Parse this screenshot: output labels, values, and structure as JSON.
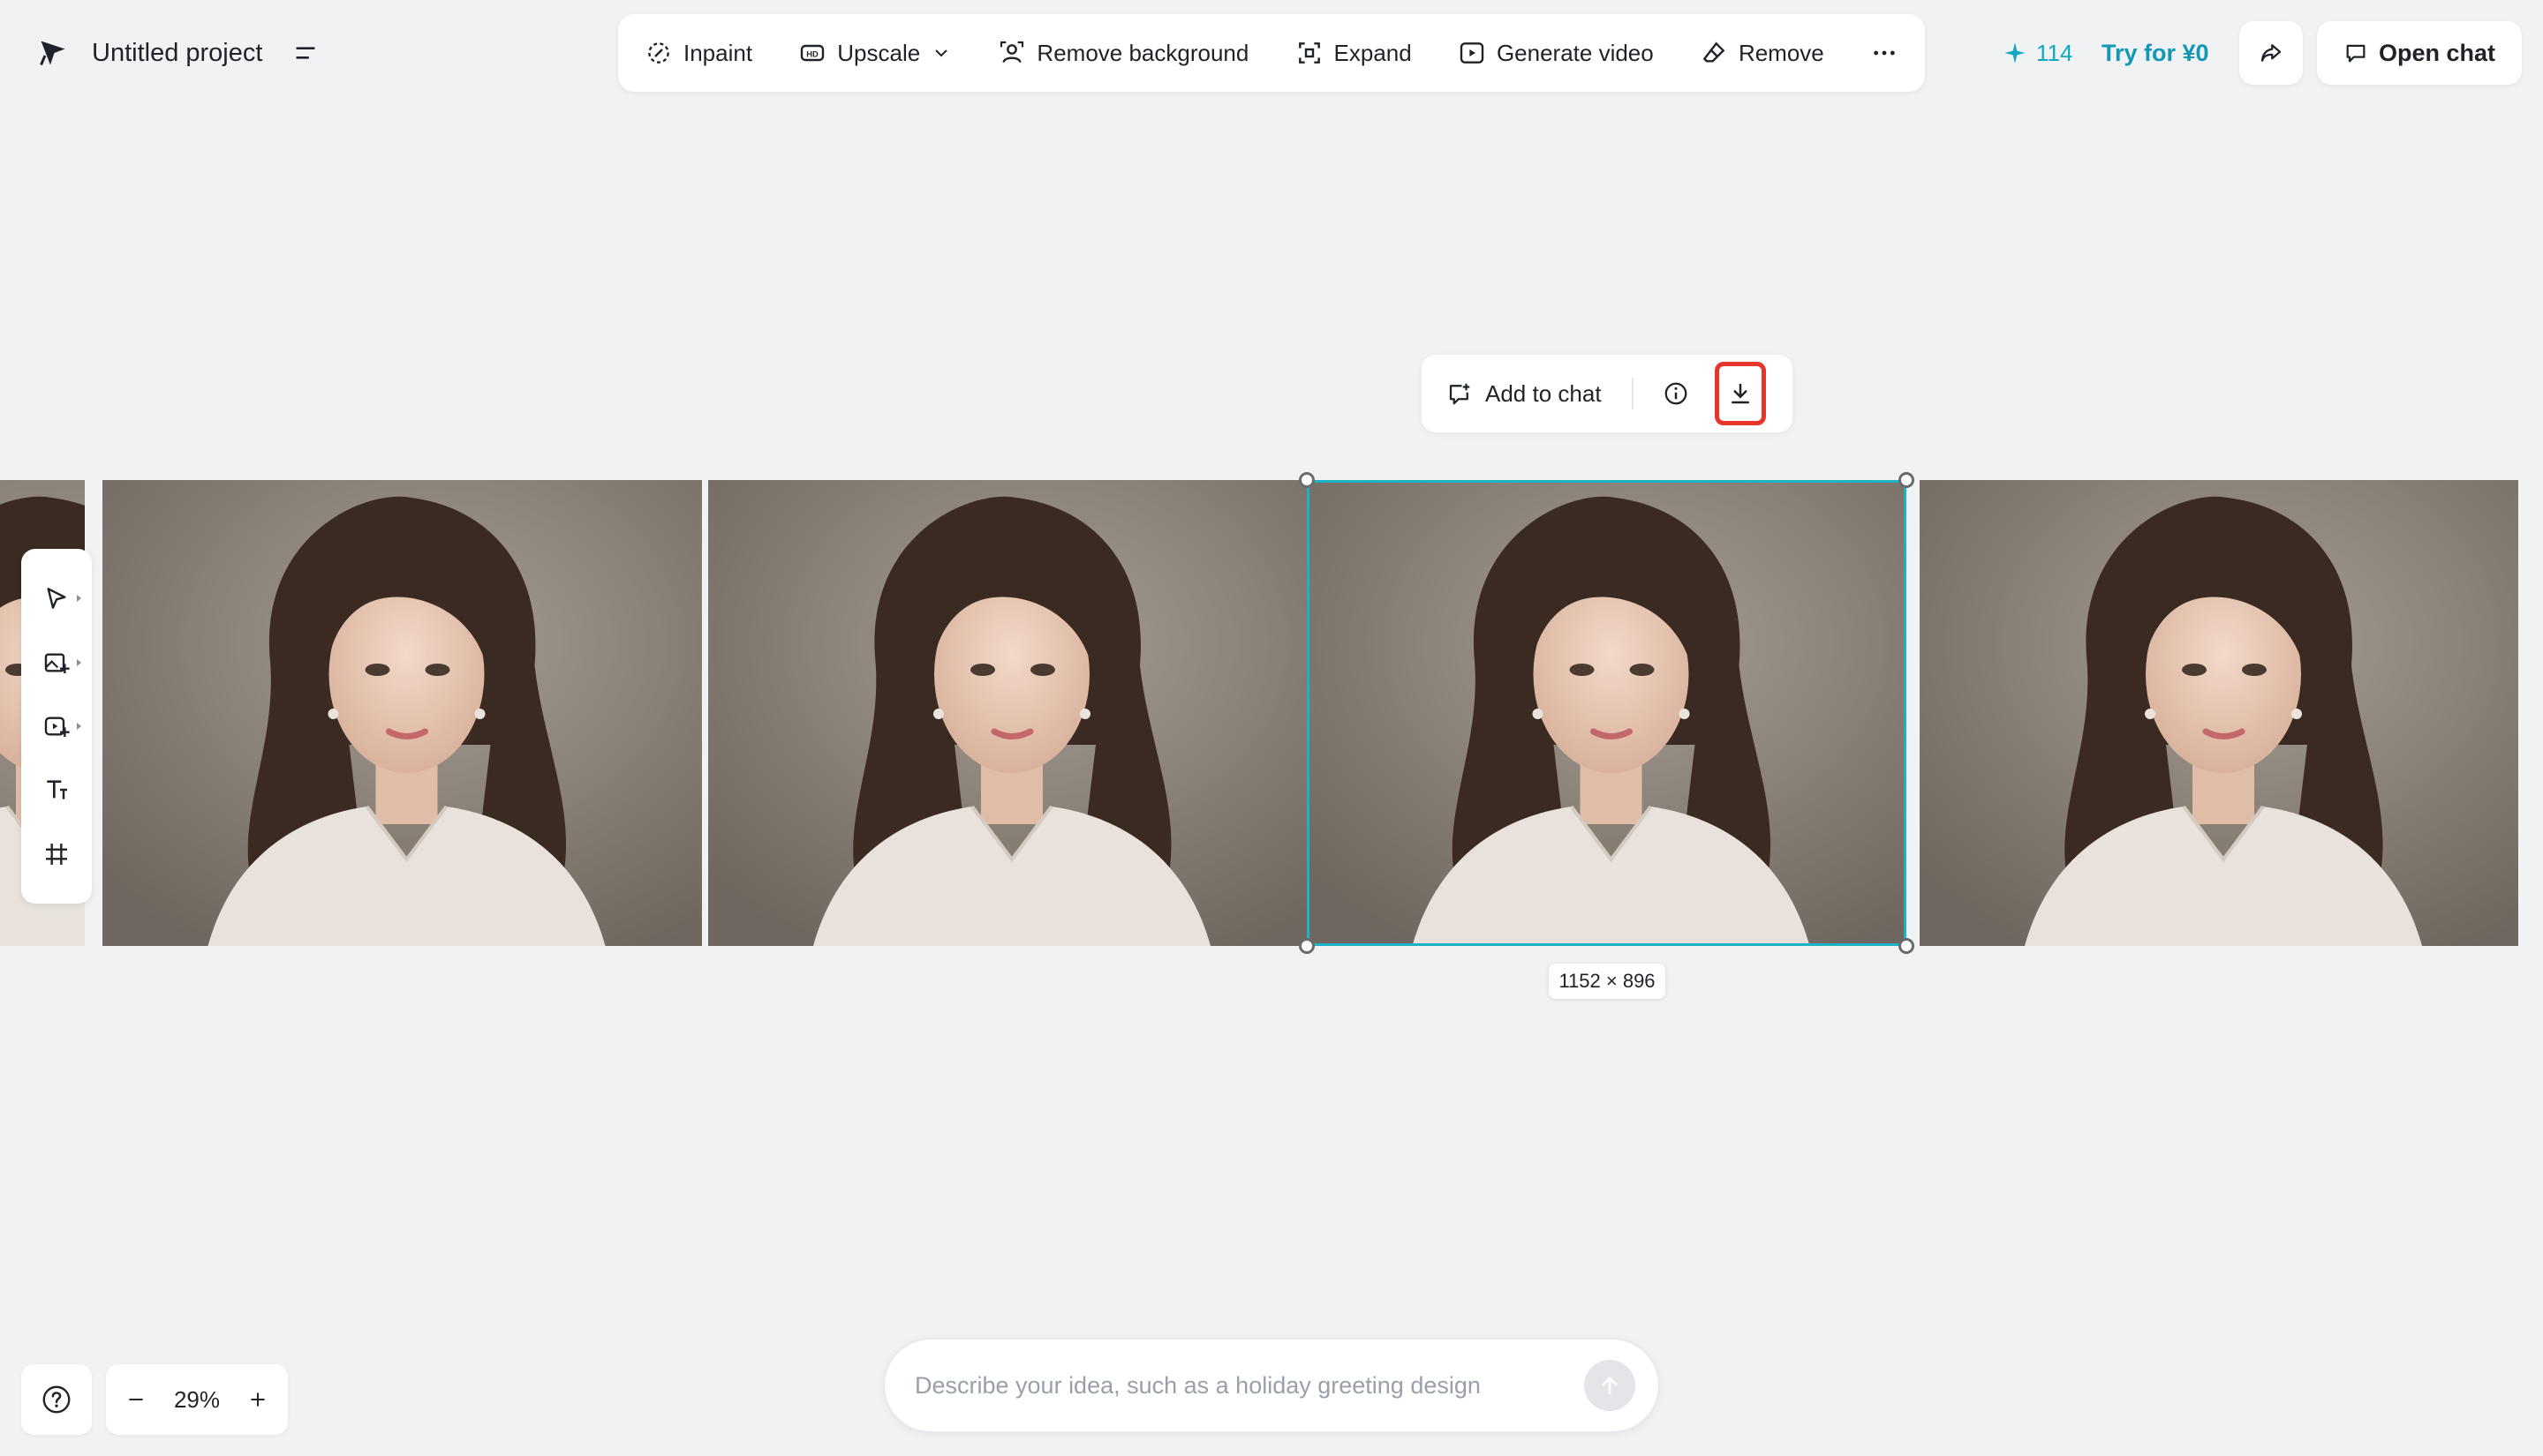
{
  "header": {
    "project_title": "Untitled project"
  },
  "toolbar": {
    "items": [
      {
        "label": "Inpaint",
        "icon": "inpaint-icon"
      },
      {
        "label": "Upscale",
        "icon": "hd-icon"
      },
      {
        "label": "Remove background",
        "icon": "remove-background-icon"
      },
      {
        "label": "Expand",
        "icon": "expand-icon"
      },
      {
        "label": "Generate video",
        "icon": "play-icon"
      },
      {
        "label": "Remove",
        "icon": "eraser-icon"
      }
    ],
    "more_icon": "more-icon"
  },
  "header_right": {
    "credits": "114",
    "try_label": "Try for ¥0",
    "open_chat_label": "Open chat",
    "accent_color": "#12a8bf"
  },
  "context_bar": {
    "add_to_chat_label": "Add to chat"
  },
  "canvas": {
    "selected_dimensions": "1152 × 896",
    "selection_color": "#1db3c4"
  },
  "zoom": {
    "value": "29%"
  },
  "prompt": {
    "placeholder": "Describe your idea, such as a holiday greeting design"
  }
}
